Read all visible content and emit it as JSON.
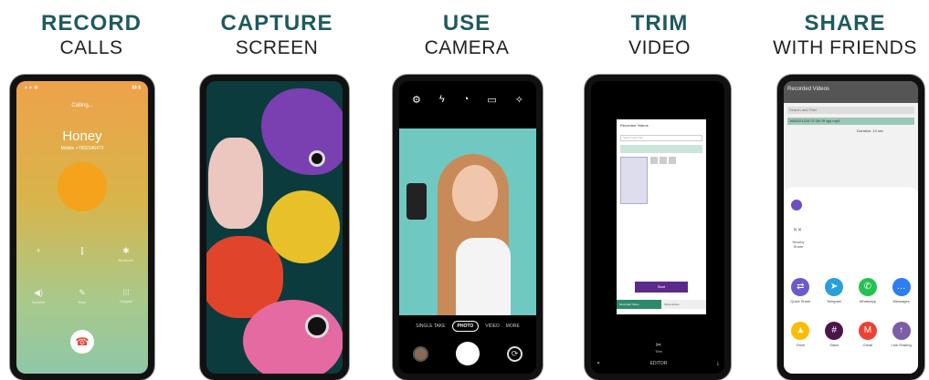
{
  "features": [
    {
      "title": "RECORD",
      "subtitle": "CALLS"
    },
    {
      "title": "CAPTURE",
      "subtitle": "SCREEN"
    },
    {
      "title": "USE",
      "subtitle": "CAMERA"
    },
    {
      "title": "TRIM",
      "subtitle": "VIDEO"
    },
    {
      "title": "SHARE",
      "subtitle": "WITH FRIENDS"
    }
  ],
  "call": {
    "calling": "Calling...",
    "name": "Honey",
    "number": "Mobile +7992346473",
    "buttons": [
      "Speaker",
      "Mute",
      "Keypad"
    ],
    "top_buttons": [
      "Bluetooth"
    ]
  },
  "camera": {
    "modes": [
      "SINGLE TAKE",
      "PHOTO",
      "VIDEO",
      "MORE"
    ]
  },
  "editor": {
    "header": "Recorded Videos",
    "search": "Search and Trim",
    "action": "Start",
    "tab_left": "Recorded Video",
    "tab_right": "Screenshots",
    "trim_label": "Trim",
    "bottom_label": "EDITOR"
  },
  "share": {
    "header": "Recorded Videos",
    "search": "Search and Filter",
    "file": "1683321224 07:26:09 vgs.mp4",
    "duration": "Duration: 10 sec",
    "nearby_label": "Nearby Share",
    "apps": [
      {
        "name": "Quick Share",
        "color": "#6a5acd",
        "icon": "quick-share-icon"
      },
      {
        "name": "Telegram",
        "color": "#2aa0da",
        "icon": "telegram-icon"
      },
      {
        "name": "WhatsApp",
        "color": "#25c153",
        "icon": "whatsapp-icon"
      },
      {
        "name": "Messages",
        "color": "#2e7cf6",
        "icon": "messages-icon"
      },
      {
        "name": "Drive",
        "color": "#fbbc04",
        "icon": "drive-icon"
      },
      {
        "name": "Slack",
        "color": "#4a154b",
        "icon": "slack-icon"
      },
      {
        "name": "Gmail",
        "color": "#ea4335",
        "icon": "gmail-icon"
      },
      {
        "name": "Link Sharing",
        "color": "#7b5ea7",
        "icon": "link-sharing-icon"
      }
    ]
  }
}
